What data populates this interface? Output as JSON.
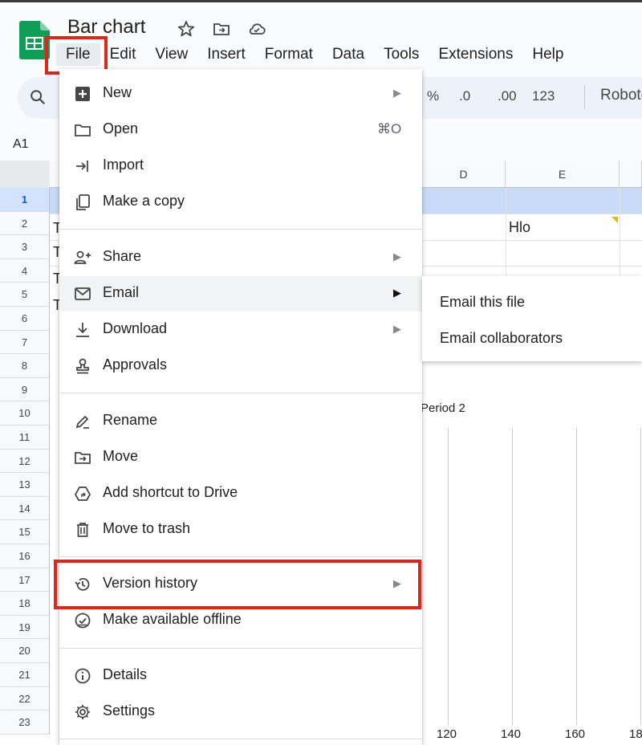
{
  "doc": {
    "title": "Bar chart"
  },
  "menubar": [
    "File",
    "Edit",
    "View",
    "Insert",
    "Format",
    "Data",
    "Tools",
    "Extensions",
    "Help"
  ],
  "toolbar": {
    "percent": "%",
    "dec_decrease": ".0",
    "dec_increase": ".00",
    "number_format": "123",
    "font": "Roboto"
  },
  "namebox": {
    "value": "A1"
  },
  "grid": {
    "columns": [
      "D",
      "E"
    ],
    "rows": [
      "1",
      "2",
      "3",
      "4",
      "5",
      "6",
      "7",
      "8",
      "9",
      "10",
      "11",
      "12",
      "13",
      "14",
      "15",
      "16",
      "17",
      "18",
      "19",
      "20",
      "21",
      "22",
      "23"
    ],
    "cells": {
      "E2": "Hlo",
      "B2": "T",
      "B3": "T",
      "B4": "T",
      "B5": "T"
    }
  },
  "chart": {
    "title": "Period 2",
    "ticks": [
      "120",
      "140",
      "160",
      "18"
    ]
  },
  "file_menu": {
    "group1": [
      {
        "label": "New",
        "icon": "new-plus-icon",
        "submenu": true
      },
      {
        "label": "Open",
        "icon": "folder-icon",
        "shortcut": "⌘O"
      },
      {
        "label": "Import",
        "icon": "import-icon"
      },
      {
        "label": "Make a copy",
        "icon": "copy-icon"
      }
    ],
    "group2": [
      {
        "label": "Share",
        "icon": "share-person-icon",
        "submenu": true
      },
      {
        "label": "Email",
        "icon": "mail-icon",
        "submenu": true
      },
      {
        "label": "Download",
        "icon": "download-icon",
        "submenu": true
      },
      {
        "label": "Approvals",
        "icon": "approvals-stamp-icon"
      }
    ],
    "group3": [
      {
        "label": "Rename",
        "icon": "rename-pencil-icon"
      },
      {
        "label": "Move",
        "icon": "move-folder-icon"
      },
      {
        "label": "Add shortcut to Drive",
        "icon": "drive-shortcut-icon"
      },
      {
        "label": "Move to trash",
        "icon": "trash-icon"
      }
    ],
    "group4": [
      {
        "label": "Version history",
        "icon": "history-icon",
        "submenu": true
      },
      {
        "label": "Make available offline",
        "icon": "offline-icon"
      }
    ],
    "group5": [
      {
        "label": "Details",
        "icon": "info-icon"
      },
      {
        "label": "Settings",
        "icon": "settings-gear-icon"
      }
    ]
  },
  "email_submenu": [
    "Email this file",
    "Email collaborators"
  ],
  "colors": {
    "highlight": "#e1251b",
    "sheets_green": "#0f9d58",
    "row_selected": "#c9daf8"
  }
}
